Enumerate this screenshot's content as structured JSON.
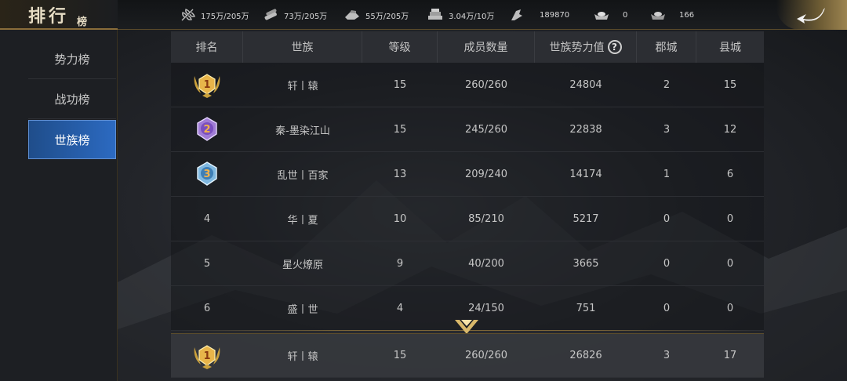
{
  "title": {
    "main": "排行",
    "sub": "榜"
  },
  "resources": [
    {
      "icon": "wheat-icon",
      "value": "175万/205万"
    },
    {
      "icon": "wood-icon",
      "value": "73万/205万"
    },
    {
      "icon": "iron-icon",
      "value": "55万/205万"
    },
    {
      "icon": "stone-icon",
      "value": "3.04万/10万"
    },
    {
      "icon": "order-icon",
      "value": "189870"
    },
    {
      "icon": "gold-ingot-icon",
      "value": "0"
    },
    {
      "icon": "silver-ingot-icon",
      "value": "166"
    }
  ],
  "sidebar": {
    "items": [
      {
        "label": "势力榜",
        "active": false
      },
      {
        "label": "战功榜",
        "active": false
      },
      {
        "label": "世族榜",
        "active": true
      }
    ]
  },
  "table": {
    "headers": [
      "排名",
      "世族",
      "等级",
      "成员数量",
      "世族势力值",
      "郡城",
      "县城"
    ],
    "rows": [
      {
        "rank": "1",
        "clan": "轩丨辕",
        "level": "15",
        "members": "260/260",
        "power": "24804",
        "commanderies": "2",
        "counties": "15"
      },
      {
        "rank": "2",
        "clan": "秦-墨染江山",
        "level": "15",
        "members": "245/260",
        "power": "22838",
        "commanderies": "3",
        "counties": "12"
      },
      {
        "rank": "3",
        "clan": "乱世丨百家",
        "level": "13",
        "members": "209/240",
        "power": "14174",
        "commanderies": "1",
        "counties": "6"
      },
      {
        "rank": "4",
        "clan": "华丨夏",
        "level": "10",
        "members": "85/210",
        "power": "5217",
        "commanderies": "0",
        "counties": "0"
      },
      {
        "rank": "5",
        "clan": "星火燎原",
        "level": "9",
        "members": "40/200",
        "power": "3665",
        "commanderies": "0",
        "counties": "0"
      },
      {
        "rank": "6",
        "clan": "盛丨世",
        "level": "4",
        "members": "24/150",
        "power": "751",
        "commanderies": "0",
        "counties": "0"
      }
    ],
    "my_row": {
      "rank": "1",
      "clan": "轩丨辕",
      "level": "15",
      "members": "260/260",
      "power": "26826",
      "commanderies": "3",
      "counties": "17"
    }
  },
  "colors": {
    "gold_medal": "#e8b54a",
    "silver_medal": "#a07cd6",
    "bronze_medal": "#7fb8e0",
    "active_tab": "#2c6ac1",
    "gold_accent": "#8a6d3a"
  }
}
